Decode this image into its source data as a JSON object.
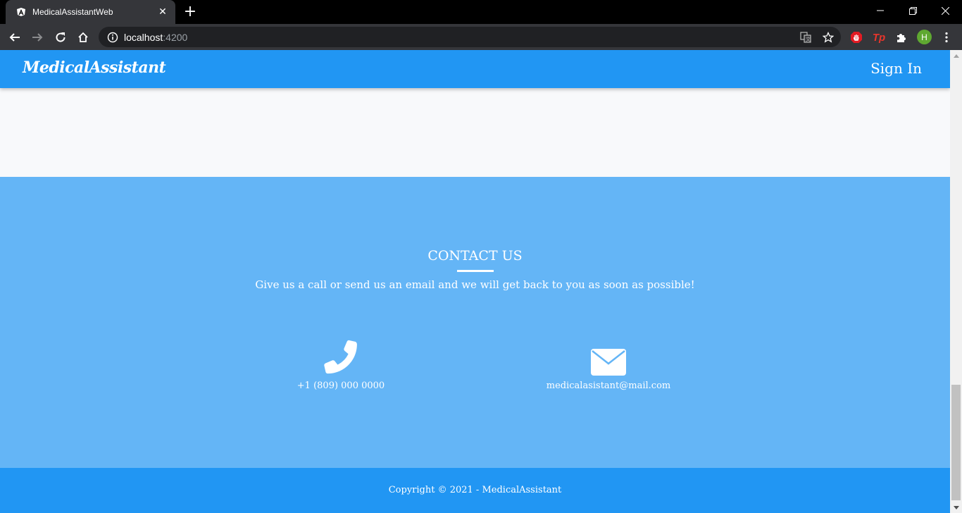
{
  "browser": {
    "tab_title": "MedicalAssistantWeb",
    "url_host": "localhost",
    "url_port": ":4200",
    "profile_initial": "H",
    "icons": {
      "favicon": "angular-icon",
      "back": "back-arrow-icon",
      "forward": "forward-arrow-icon",
      "reload": "reload-icon",
      "home": "home-icon",
      "info": "info-icon",
      "translate": "translate-icon",
      "bookmark": "star-icon",
      "extensions": [
        "adblock-icon",
        "tp-icon",
        "puzzle-icon"
      ],
      "menu": "kebab-menu-icon"
    }
  },
  "navbar": {
    "brand": "MedicalAssistant",
    "signin_label": "Sign In"
  },
  "contact": {
    "title": "CONTACT US",
    "subtitle": "Give us a call or send us an email and we will get back to you as soon as possible!",
    "phone": "+1 (809) 000 0000",
    "email": "medicalasistant@mail.com",
    "icons": {
      "phone": "phone-icon",
      "email": "envelope-icon"
    }
  },
  "footer": {
    "copyright": "Copyright © 2021 - MedicalAssistant"
  },
  "colors": {
    "primary": "#2196f3",
    "contact_bg": "#64b5f6",
    "page_bg": "#f8f9fb",
    "chrome_dark": "#35363a"
  }
}
